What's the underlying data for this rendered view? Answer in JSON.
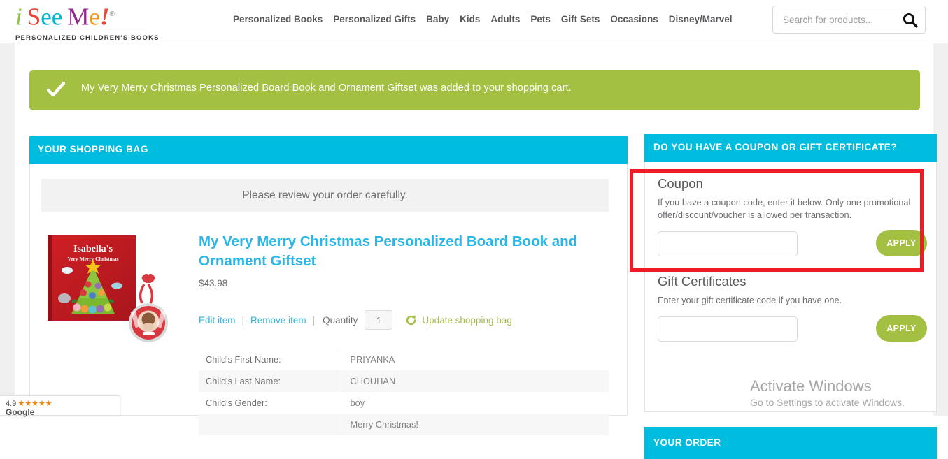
{
  "header": {
    "logo": {
      "part1": "i",
      "part2": "S",
      "part3": "ee",
      "part4": "M",
      "part5": "e",
      "part6": "!",
      "registered": "®",
      "tagline": "PERSONALIZED CHILDREN'S BOOKS"
    },
    "nav": [
      "Personalized Books",
      "Personalized Gifts",
      "Baby",
      "Kids",
      "Adults",
      "Pets",
      "Gift Sets",
      "Occasions",
      "Disney/Marvel"
    ],
    "search": {
      "placeholder": "Search for products...",
      "value": "",
      "icon": "search-icon"
    }
  },
  "banner": {
    "icon": "check-icon",
    "message": "My Very Merry Christmas Personalized Board Book and Ornament Giftset was added to your shopping cart.",
    "color": "#a3c043"
  },
  "shopping_bag": {
    "header_title": "YOUR SHOPPING BAG",
    "header_color": "#00bcde",
    "review_notice": "Please review your order carefully.",
    "item": {
      "title": "My Very Merry Christmas Personalized Board Book and Ornament Giftset",
      "title_color": "#29b6e8",
      "price": "$43.98",
      "edit_label": "Edit item",
      "remove_label": "Remove item",
      "separator": "|",
      "quantity_label": "Quantity",
      "quantity_value": "1",
      "update_label": "Update shopping bag",
      "update_icon": "refresh-icon",
      "image": {
        "book_name": "Isabella's",
        "book_subtitle": "Very Merry Christmas",
        "alt": "Personalized board book and photo ornament giftset"
      }
    },
    "personalization": [
      {
        "key": "Child's First Name:",
        "value": "PRIYANKA"
      },
      {
        "key": "Child's Last Name:",
        "value": "CHOUHAN"
      },
      {
        "key": "Child's Gender:",
        "value": "boy"
      },
      {
        "key": "",
        "value": "Merry Christmas!"
      }
    ]
  },
  "coupon_panel": {
    "header_title": "DO YOU HAVE A COUPON OR GIFT CERTIFICATE?",
    "header_color": "#00bcde",
    "coupon": {
      "title": "Coupon",
      "description": "If you have a coupon code, enter it below. Only one promotional offer/discount/voucher is allowed per transaction.",
      "input_value": "",
      "input_placeholder": "",
      "apply_label": "APPLY"
    },
    "gift_certificates": {
      "title": "Gift Certificates",
      "description": "Enter your gift certificate code if you have one.",
      "input_value": "",
      "input_placeholder": "",
      "apply_label": "APPLY"
    }
  },
  "order_panel": {
    "header_title": "YOUR ORDER",
    "header_color": "#00bcde"
  },
  "annotation": {
    "color": "#ee1c25",
    "target": "coupon-section"
  },
  "watermark": {
    "line1": "Activate Windows",
    "line2": "Go to Settings to activate Windows."
  },
  "google_review": {
    "rating": "4.9",
    "stars": "★★★★★",
    "label": "Google"
  }
}
